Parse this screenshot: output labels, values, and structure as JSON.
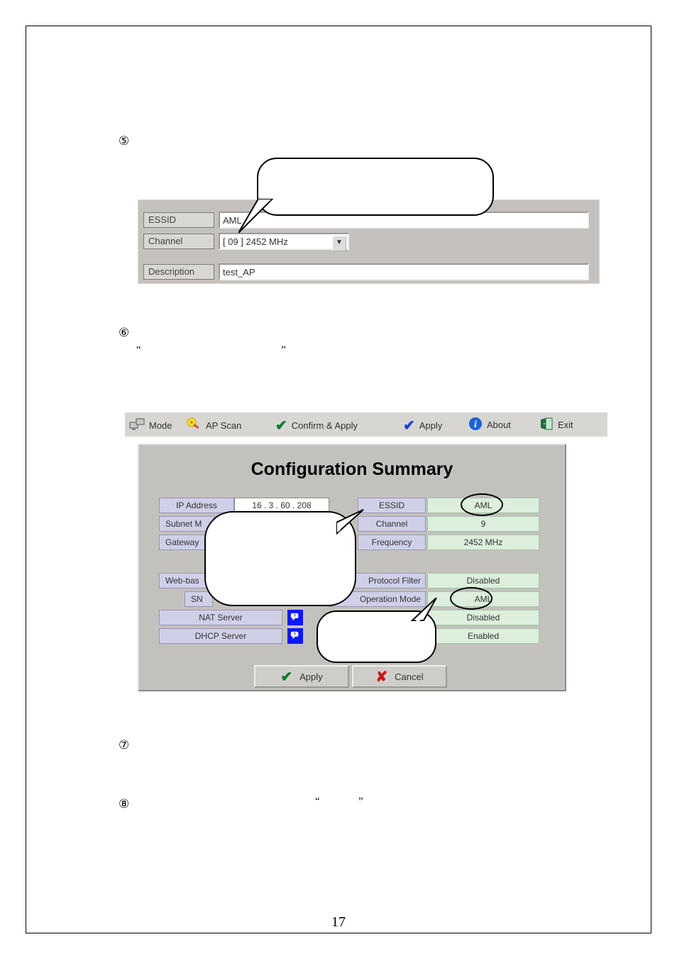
{
  "page_number": "17",
  "steps": {
    "s5": "⑤",
    "s6": "⑥",
    "s7": "⑦",
    "s8": "⑧"
  },
  "quotes": {
    "lq": "“",
    "rq": "”"
  },
  "panel1": {
    "labels": {
      "essid": "ESSID",
      "channel": "Channel",
      "description": "Description"
    },
    "values": {
      "essid": "AML",
      "channel": "[ 09 ] 2452 MHz",
      "description": "test_AP"
    }
  },
  "toolbar": {
    "mode": "Mode",
    "apscan": "AP Scan",
    "confirm": "Confirm & Apply",
    "apply": "Apply",
    "about": "About",
    "exit": "Exit"
  },
  "summary": {
    "title": "Configuration Summary",
    "left": {
      "ip_label": "IP Address",
      "ip_value": "16 . 3 . 60 . 208",
      "subnet_label": "Subnet M",
      "gateway_label": "Gateway",
      "web_label": "Web-bas",
      "sn_label": "SN",
      "nat_label": "NAT Server",
      "dhcp_label": "DHCP Server"
    },
    "right": {
      "essid_label": "ESSID",
      "essid_value": "AML",
      "channel_label": "Channel",
      "channel_value": "9",
      "freq_label": "Frequency",
      "freq_value": "2452 MHz",
      "pf_label": "Protocol Filter",
      "pf_value": "Disabled",
      "op_label": "Operation Mode",
      "op_value": "AML",
      "row3_value": "Disabled",
      "row4_value": "Enabled"
    },
    "buttons": {
      "apply": "Apply",
      "cancel": "Cancel"
    }
  }
}
